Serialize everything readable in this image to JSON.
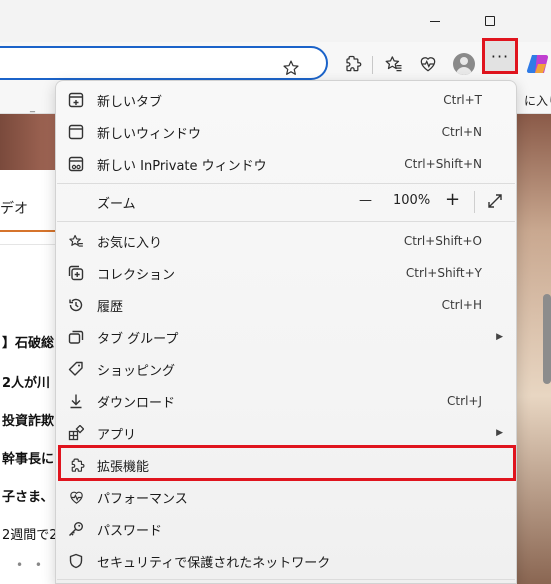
{
  "window": {
    "minimize_icon": "minimize-icon",
    "maximize_icon": "maximize-icon"
  },
  "toolbar": {
    "more_label": "···",
    "icons": [
      "favorite-star-icon",
      "extensions-icon",
      "favorites-icon",
      "performance-icon",
      "profile-avatar",
      "copilot-icon"
    ]
  },
  "favorites_bar": {
    "text": "に入り",
    "underscore": "_"
  },
  "page": {
    "tab_text": "デオ",
    "headlines": [
      "】石破総",
      "2人が川",
      "投資詐欺",
      "幹事長に",
      "子さま、",
      "2週間で2"
    ],
    "dots": "• • •"
  },
  "menu": {
    "items": [
      {
        "label": "新しいタブ",
        "shortcut": "Ctrl+T",
        "icon": "new-tab-icon"
      },
      {
        "label": "新しいウィンドウ",
        "shortcut": "Ctrl+N",
        "icon": "new-window-icon"
      },
      {
        "label": "新しい InPrivate ウィンドウ",
        "shortcut": "Ctrl+Shift+N",
        "icon": "inprivate-window-icon"
      },
      {
        "label": "お気に入り",
        "shortcut": "Ctrl+Shift+O",
        "icon": "favorites-icon"
      },
      {
        "label": "コレクション",
        "shortcut": "Ctrl+Shift+Y",
        "icon": "collections-icon"
      },
      {
        "label": "履歴",
        "shortcut": "Ctrl+H",
        "icon": "history-icon"
      },
      {
        "label": "タブ グループ",
        "shortcut": "",
        "icon": "tab-groups-icon"
      },
      {
        "label": "ショッピング",
        "shortcut": "",
        "icon": "shopping-tag-icon"
      },
      {
        "label": "ダウンロード",
        "shortcut": "Ctrl+J",
        "icon": "download-icon"
      },
      {
        "label": "アプリ",
        "shortcut": "",
        "icon": "apps-icon"
      },
      {
        "label": "拡張機能",
        "shortcut": "",
        "icon": "extensions-icon"
      },
      {
        "label": "パフォーマンス",
        "shortcut": "",
        "icon": "performance-icon"
      },
      {
        "label": "パスワード",
        "shortcut": "",
        "icon": "password-key-icon"
      },
      {
        "label": "セキュリティで保護されたネットワーク",
        "shortcut": "",
        "icon": "secure-network-shield-icon"
      }
    ],
    "zoom": {
      "label": "ズーム",
      "minus": "—",
      "value": "100%",
      "plus": "+",
      "fullscreen_icon": "fullscreen-icon"
    },
    "highlighted_item": "拡張機能"
  },
  "colors": {
    "highlight_border": "#e0141e",
    "address_border": "#1b63c9"
  }
}
